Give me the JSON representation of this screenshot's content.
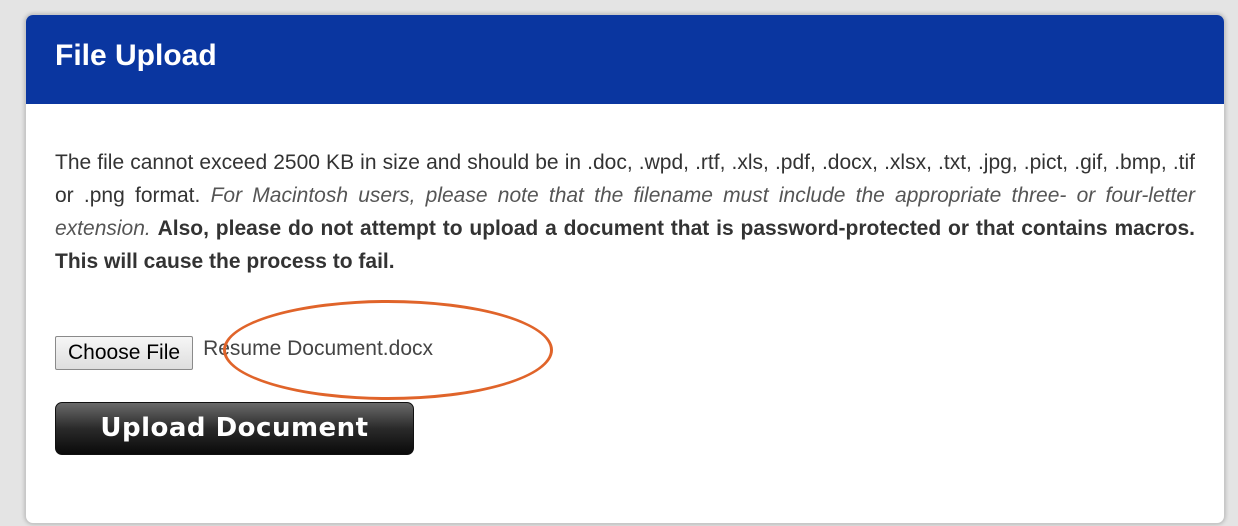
{
  "panel": {
    "title": "File Upload"
  },
  "instructions": {
    "plain": "The file cannot exceed 2500 KB in size and should be in .doc, .wpd, .rtf, .xls, .pdf, .docx, .xlsx, .txt, .jpg, .pict, .gif, .bmp, .tif or .png format. ",
    "italic": "For Macintosh users, please note that the filename must include the appropriate three- or four-letter extension.",
    "bold": "Also, please do not attempt to upload a document that is password-protected or that contains macros. This will cause the process to fail."
  },
  "file_input": {
    "button_label": "Choose File",
    "selected_file": "Resume Document.docx"
  },
  "upload": {
    "button_label": "Upload Document"
  },
  "colors": {
    "header_bg": "#0a36a0",
    "highlight_ellipse": "#e0642a"
  }
}
